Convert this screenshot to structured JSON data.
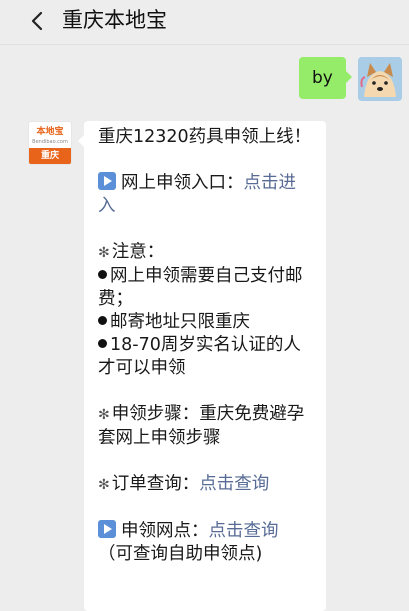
{
  "header": {
    "back_icon": "chevron-left-icon",
    "title": "重庆本地宝"
  },
  "outgoing": {
    "text": "by",
    "avatar_icon": "shiba-dog-avatar"
  },
  "account": {
    "avatar_logo_text": "本地宝",
    "avatar_url_text": "Bendibao.com",
    "avatar_city": "重庆"
  },
  "message": {
    "headline": "重庆12320药具申领上线！",
    "entry_label": "网上申领入口：",
    "entry_link_1": "点击进",
    "entry_link_2": "入",
    "notice_title": "注意：",
    "notice_1a": "网上申领需要自己支付邮",
    "notice_1b": "费；",
    "notice_2": "邮寄地址只限重庆",
    "notice_3a": "18-70周岁实名认证的人",
    "notice_3b": "才可以申领",
    "steps_a": "申领步骤：重庆免费避孕",
    "steps_b": "套网上申领步骤",
    "order_label": "订单查询：",
    "order_link": "点击查询",
    "point_label": "申领网点：",
    "point_link": "点击查询",
    "point_note": "（可查询自助申领点)"
  },
  "colors": {
    "link": "#576b95",
    "outgoing_bubble": "#95ec69",
    "brand_orange": "#e8641b",
    "play_icon": "#5b8fd8"
  }
}
